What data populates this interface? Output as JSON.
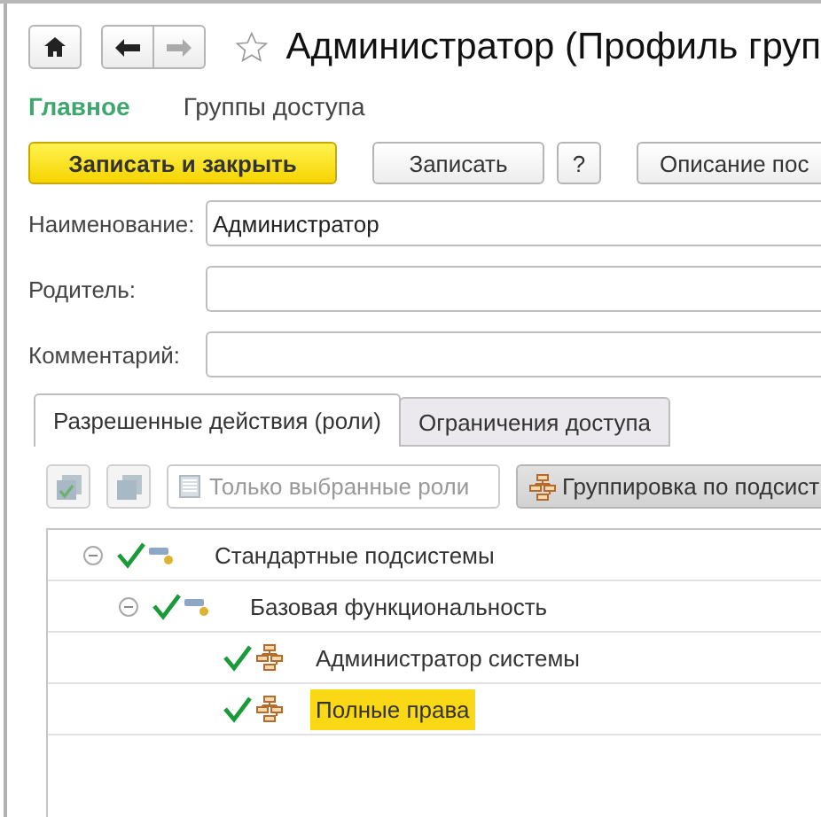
{
  "title": "Администратор (Профиль груп",
  "nav_links": [
    {
      "label": "Главное",
      "selected": true
    },
    {
      "label": "Группы доступа",
      "selected": false
    }
  ],
  "command_bar": {
    "primary": "Записать и закрыть",
    "save": "Записать",
    "help": "?",
    "description": "Описание пос"
  },
  "fields": [
    {
      "label": "Наименование:",
      "value": "Администратор"
    },
    {
      "label": "Родитель:"
    },
    {
      "label": "Комментарий:"
    }
  ],
  "tabs": [
    {
      "label": "Разрешенные действия (роли)",
      "selected": true
    },
    {
      "label": "Ограничения доступа",
      "selected": false
    }
  ],
  "toolbar": {
    "only_selected": {
      "label": "Только выбранные роли",
      "checked": false
    },
    "grouping": {
      "label": "Группировка по подсист",
      "pressed": true
    }
  },
  "tree": [
    {
      "kind": "subsystem",
      "label": "Стандартные подсистемы",
      "checked": true,
      "expanded": true,
      "selected": false,
      "children": [
        {
          "kind": "subsystem",
          "label": "Базовая функциональность",
          "checked": true,
          "expanded": true,
          "selected": false,
          "children": [
            {
              "kind": "role",
              "label": "Администратор системы",
              "checked": true,
              "selected": false
            },
            {
              "kind": "role",
              "label": "Полные права",
              "checked": true,
              "selected": true
            }
          ]
        }
      ]
    }
  ]
}
